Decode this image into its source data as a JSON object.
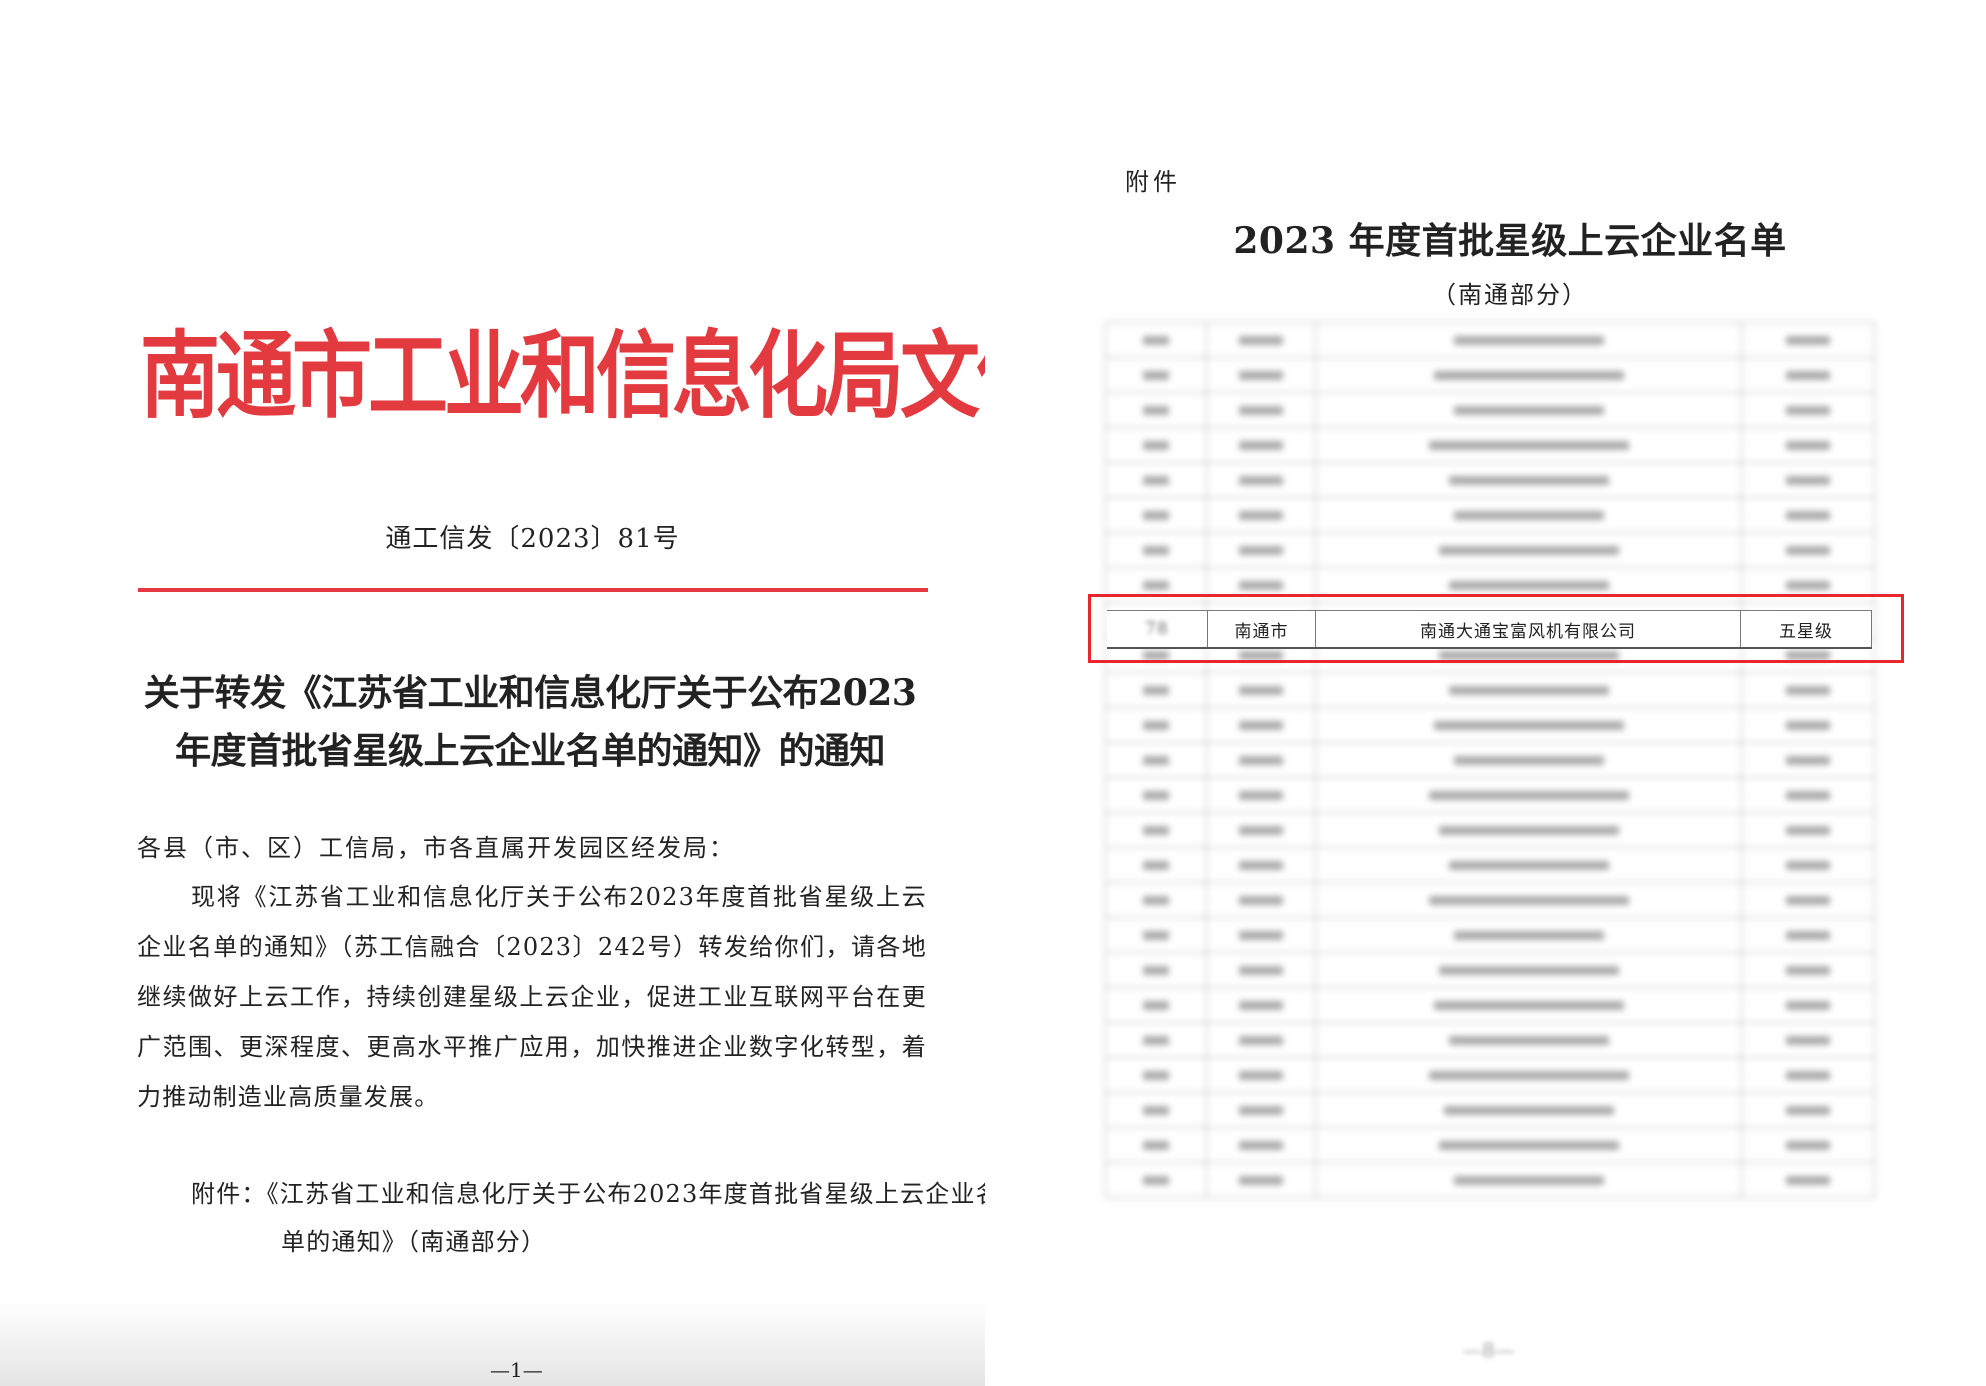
{
  "left_page": {
    "header": "南通市工业和信息化局文件",
    "doc_number": "通工信发〔2023〕81号",
    "title_lines": [
      "关于转发《江苏省工业和信息化厅关于公布2023",
      "年度首批省星级上云企业名单的通知》的通知"
    ],
    "recipient": "各县（市、区）工信局，市各直属开发园区经发局：",
    "body": "现将《江苏省工业和信息化厅关于公布2023年度首批省星级上云企业名单的通知》（苏工信融合〔2023〕242号）转发给你们，请各地继续做好上云工作，持续创建星级上云企业，促进工业互联网平台在更广范围、更深程度、更高水平推广应用，加快推进企业数字化转型，着力推动制造业高质量发展。",
    "attachment": "附件：《江苏省工业和信息化厅关于公布2023年度首批省星级上云企业名单的通知》（南通部分）",
    "page_number": "—1—"
  },
  "right_page": {
    "annex_label": "附件",
    "title": "2023 年度首批星级上云企业名单",
    "subtitle": "（南通部分）",
    "highlighted_row": {
      "number": "78",
      "city": "南通市",
      "company": "南通大通宝富风机有限公司",
      "level": "五星级"
    },
    "page_number": "—8—"
  },
  "colors": {
    "header_red": "#e23a3f",
    "highlight_box": "#e8262b"
  }
}
